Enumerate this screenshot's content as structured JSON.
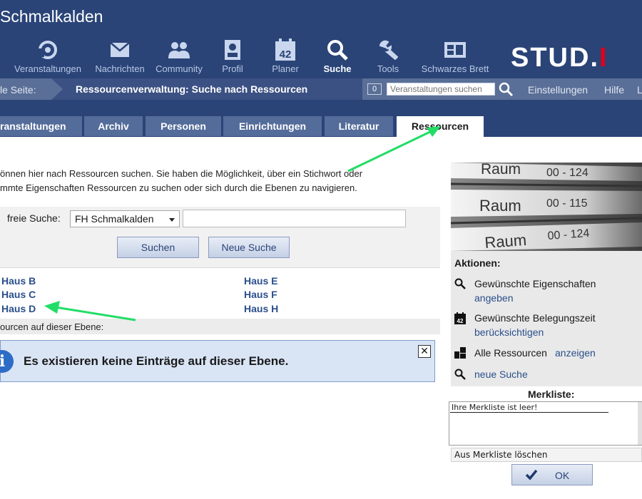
{
  "header": {
    "title": "Schmalkalden",
    "logo_main": "STUD.",
    "logo_accent": "I",
    "nav": [
      {
        "label": "Veranstaltungen",
        "icon": "seminar-icon"
      },
      {
        "label": "Nachrichten",
        "icon": "mail-icon"
      },
      {
        "label": "Community",
        "icon": "community-icon"
      },
      {
        "label": "Profil",
        "icon": "profile-icon"
      },
      {
        "label": "Planer",
        "icon": "calendar-icon"
      },
      {
        "label": "Suche",
        "icon": "search-icon",
        "active": true
      },
      {
        "label": "Tools",
        "icon": "wrench-icon"
      },
      {
        "label": "Schwarzes Brett",
        "icon": "board-icon"
      }
    ],
    "calendar_day": "42"
  },
  "breadcrumb": {
    "label": "le Seite:",
    "page": "Ressourcenverwaltung: Suche nach Ressourcen",
    "count": "0",
    "search_placeholder": "Veranstaltungen suchen",
    "settings": "Einstellungen",
    "help": "Hilfe",
    "more": "L"
  },
  "tabs": [
    {
      "label": "ranstaltungen"
    },
    {
      "label": "Archiv"
    },
    {
      "label": "Personen"
    },
    {
      "label": "Einrichtungen"
    },
    {
      "label": "Literatur"
    },
    {
      "label": "Ressourcen",
      "active": true
    }
  ],
  "main": {
    "intro_line1": "önnen hier nach Ressourcen suchen. Sie haben die Möglichkeit, über ein Stichwort oder",
    "intro_line2": "mmte Eigenschaften Ressourcen zu suchen oder sich durch die Ebenen zu navigieren.",
    "freesearch_label": "freie Suche:",
    "scope_value": "FH Schmalkalden",
    "search_button": "Suchen",
    "new_search_button": "Neue Suche",
    "houses_left": [
      "Haus B",
      "Haus C",
      "Haus D"
    ],
    "houses_right": [
      "Haus E",
      "Haus F",
      "Haus H"
    ],
    "level_label": "ourcen auf dieser Ebene:",
    "info_text": "Es existieren keine Einträge auf dieser Ebene."
  },
  "sidebar": {
    "photo_labels": [
      "Raum",
      "00 - 124",
      "Raum",
      "00 - 115",
      "Raum",
      "00 - 124"
    ],
    "actions_title": "Aktionen:",
    "actions": [
      {
        "text": "Gewünschte Eigenschaften",
        "link": "angeben",
        "icon": "search-icon"
      },
      {
        "text": "Gewünschte Belegungszeit",
        "link": "berücksichtigen",
        "icon": "calendar-icon"
      },
      {
        "text": "Alle Ressourcen",
        "link": "anzeigen",
        "icon": "resources-icon"
      },
      {
        "text": "",
        "link": "neue Suche",
        "icon": "search-icon"
      }
    ],
    "merkliste_title": "Merkliste:",
    "merkliste_empty": "Ihre Merkliste ist leer!",
    "merkliste_delete": "Aus Merkliste löschen",
    "ok_button": "OK"
  },
  "colors": {
    "header_bg": "#2a4478",
    "crumb_bg": "#5a6f97",
    "tab_bg": "#546c9a",
    "link": "#2a4f8c",
    "annotation_arrow": "#22dd66"
  }
}
